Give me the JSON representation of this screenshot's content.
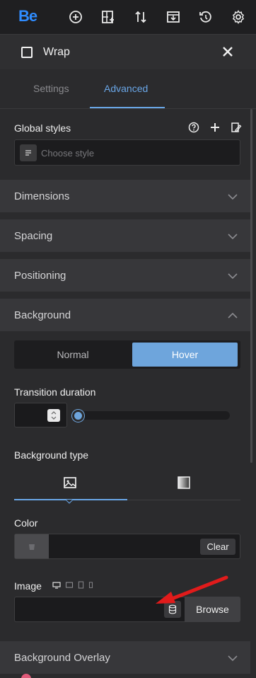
{
  "toolbar": {
    "logo": "Be",
    "icons": [
      "add-circle-icon",
      "layout-add-icon",
      "sort-arrows-icon",
      "import-icon",
      "history-icon",
      "gear-icon"
    ]
  },
  "header": {
    "title": "Wrap",
    "close_icon": "close-icon"
  },
  "tabs": [
    {
      "label": "Settings"
    },
    {
      "label": "Advanced"
    }
  ],
  "global_styles": {
    "label": "Global styles",
    "placeholder": "Choose style"
  },
  "sections": [
    {
      "label": "Dimensions",
      "state": "collapsed"
    },
    {
      "label": "Spacing",
      "state": "collapsed"
    },
    {
      "label": "Positioning",
      "state": "collapsed"
    },
    {
      "label": "Background",
      "state": "expanded"
    },
    {
      "label": "Background Overlay",
      "state": "collapsed"
    }
  ],
  "background": {
    "toggle": {
      "normal": "Normal",
      "hover": "Hover",
      "selected": "Hover"
    },
    "transition_duration": {
      "label": "Transition duration",
      "value": "",
      "slider_fraction": 0
    },
    "background_type": {
      "label": "Background type",
      "options": [
        "image-icon",
        "gradient-icon"
      ],
      "selected": "image-icon"
    },
    "color": {
      "label": "Color",
      "value": "",
      "clear_label": "Clear"
    },
    "image": {
      "label": "Image",
      "value": "",
      "browse_label": "Browse",
      "device_icons": [
        "desktop-icon",
        "laptop-icon",
        "tablet-icon",
        "mobile-icon"
      ]
    }
  },
  "colors": {
    "accent": "#6aa7e8",
    "logo": "#2f8cff",
    "arrow": "#e11b1b"
  }
}
